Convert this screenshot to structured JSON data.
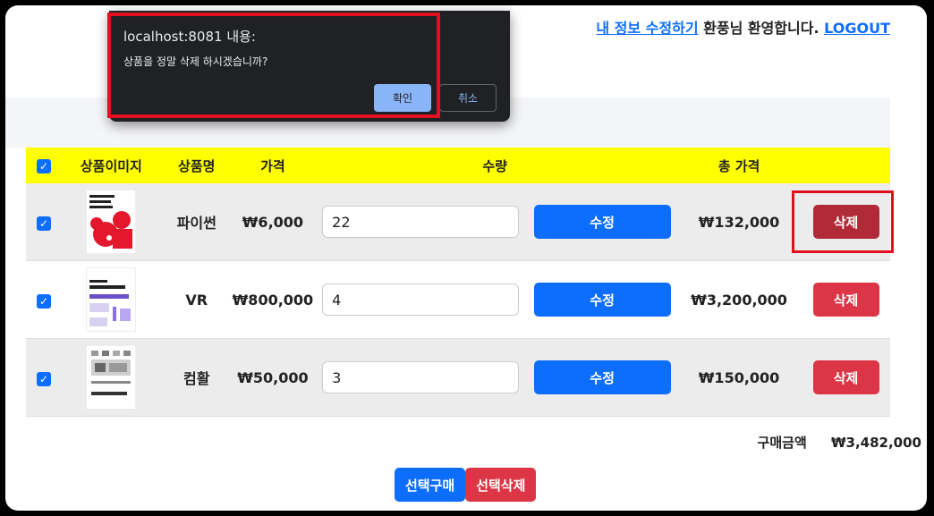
{
  "header": {
    "edit_info_link": "내 정보 수정하기",
    "greeting": " 환풍님 환영합니다. ",
    "logout_link": "LOGOUT"
  },
  "dialog": {
    "title": "localhost:8081 내용:",
    "message": "상품을 정말 삭제 하시겠습니까?",
    "ok_label": "확인",
    "cancel_label": "취소"
  },
  "table": {
    "headers": [
      "상품이미지",
      "상품명",
      "가격",
      "수량",
      "총 가격"
    ],
    "rows": [
      {
        "name": "파이썬",
        "price": "₩6,000",
        "quantity": "22",
        "update_label": "수정",
        "total": "₩132,000",
        "delete_label": "삭제"
      },
      {
        "name": "VR",
        "price": "₩800,000",
        "quantity": "4",
        "update_label": "수정",
        "total": "₩3,200,000",
        "delete_label": "삭제"
      },
      {
        "name": "컴활",
        "price": "₩50,000",
        "quantity": "3",
        "update_label": "수정",
        "total": "₩150,000",
        "delete_label": "삭제"
      }
    ]
  },
  "summary": {
    "label": "구매금액",
    "amount": "₩3,482,000"
  },
  "actions": {
    "buy_selected": "선택구매",
    "delete_selected": "선택삭제"
  },
  "colors": {
    "primary": "#0d6efd",
    "danger": "#dc3545",
    "header_bg": "#ffff00",
    "highlight": "#e01020"
  }
}
